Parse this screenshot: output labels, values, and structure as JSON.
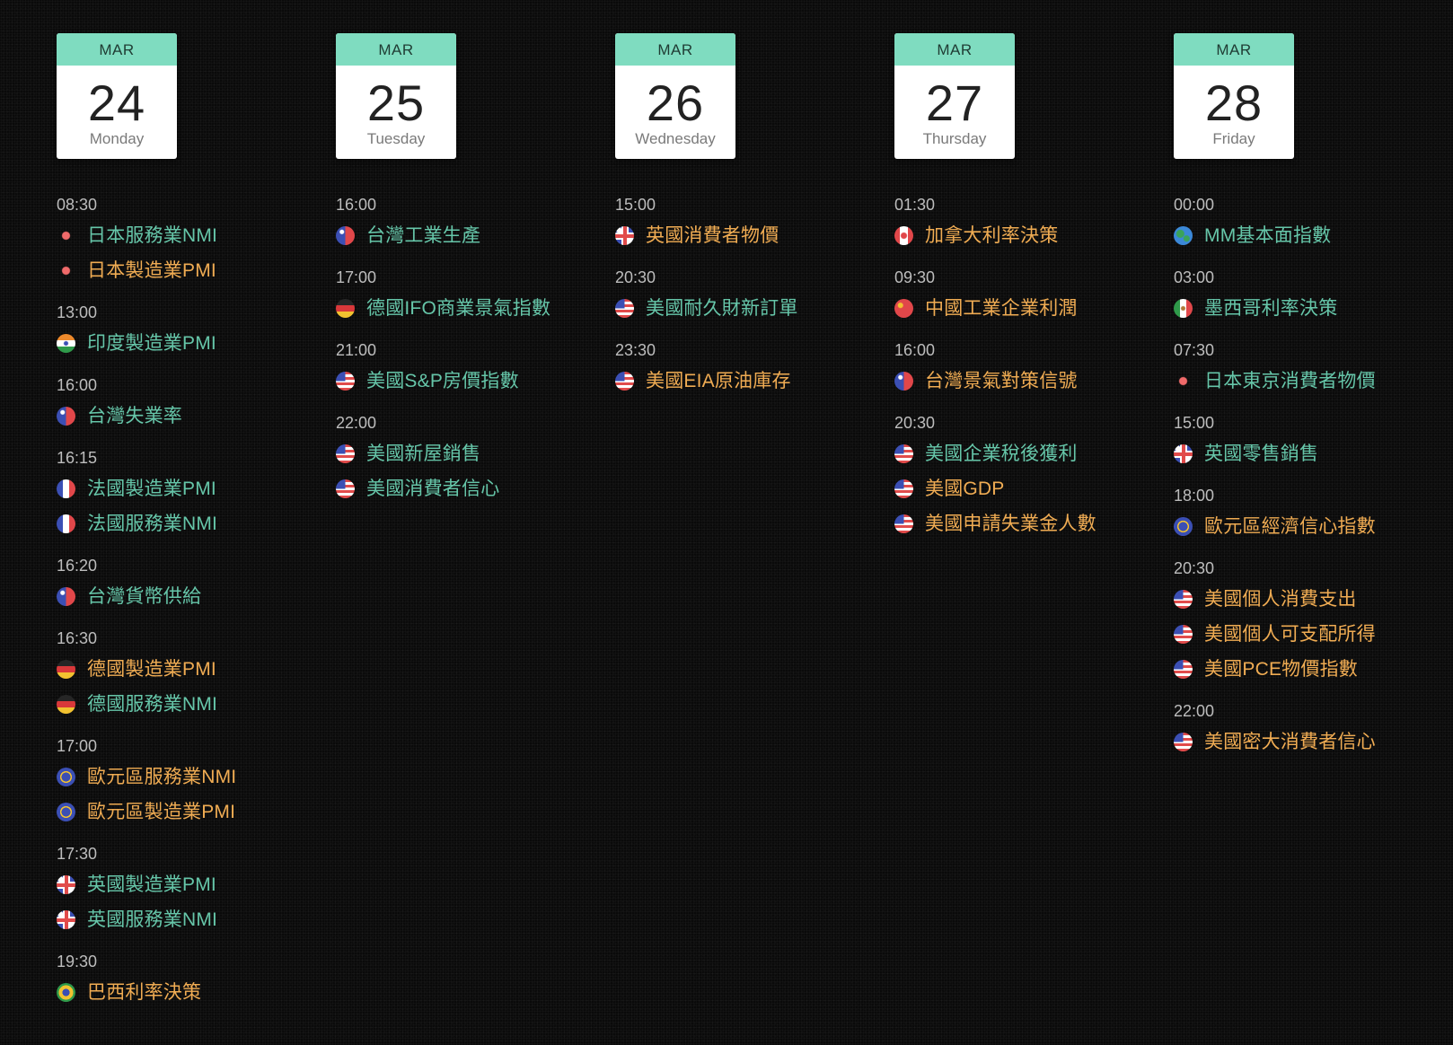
{
  "colors": {
    "accent_header": "#7fdcc0",
    "event_teal": "#66c6a9",
    "event_orange": "#f0ac53",
    "time": "#bdbdbd",
    "background": "#0a0a0a"
  },
  "days": [
    {
      "month": "MAR",
      "day": "24",
      "weekday": "Monday",
      "groups": [
        {
          "time": "08:30",
          "events": [
            {
              "flag": "japan-flag-icon",
              "name": "日本服務業NMI",
              "color": "teal"
            },
            {
              "flag": "japan-flag-icon",
              "name": "日本製造業PMI",
              "color": "orange"
            }
          ]
        },
        {
          "time": "13:00",
          "events": [
            {
              "flag": "india-flag-icon",
              "name": "印度製造業PMI",
              "color": "teal"
            }
          ]
        },
        {
          "time": "16:00",
          "events": [
            {
              "flag": "taiwan-flag-icon",
              "name": "台灣失業率",
              "color": "teal"
            }
          ]
        },
        {
          "time": "16:15",
          "events": [
            {
              "flag": "france-flag-icon",
              "name": "法國製造業PMI",
              "color": "teal"
            },
            {
              "flag": "france-flag-icon",
              "name": "法國服務業NMI",
              "color": "teal"
            }
          ]
        },
        {
          "time": "16:20",
          "events": [
            {
              "flag": "taiwan-flag-icon",
              "name": "台灣貨幣供給",
              "color": "teal"
            }
          ]
        },
        {
          "time": "16:30",
          "events": [
            {
              "flag": "germany-flag-icon",
              "name": "德國製造業PMI",
              "color": "orange"
            },
            {
              "flag": "germany-flag-icon",
              "name": "德國服務業NMI",
              "color": "teal"
            }
          ]
        },
        {
          "time": "17:00",
          "events": [
            {
              "flag": "eu-flag-icon",
              "name": "歐元區服務業NMI",
              "color": "orange"
            },
            {
              "flag": "eu-flag-icon",
              "name": "歐元區製造業PMI",
              "color": "orange"
            }
          ]
        },
        {
          "time": "17:30",
          "events": [
            {
              "flag": "uk-flag-icon",
              "name": "英國製造業PMI",
              "color": "teal"
            },
            {
              "flag": "uk-flag-icon",
              "name": "英國服務業NMI",
              "color": "teal"
            }
          ]
        },
        {
          "time": "19:30",
          "events": [
            {
              "flag": "brazil-flag-icon",
              "name": "巴西利率決策",
              "color": "orange"
            }
          ]
        }
      ]
    },
    {
      "month": "MAR",
      "day": "25",
      "weekday": "Tuesday",
      "groups": [
        {
          "time": "16:00",
          "events": [
            {
              "flag": "taiwan-flag-icon",
              "name": "台灣工業生產",
              "color": "teal"
            }
          ]
        },
        {
          "time": "17:00",
          "events": [
            {
              "flag": "germany-flag-icon",
              "name": "德國IFO商業景氣指數",
              "color": "teal"
            }
          ]
        },
        {
          "time": "21:00",
          "events": [
            {
              "flag": "usa-flag-icon",
              "name": "美國S&P房價指數",
              "color": "teal"
            }
          ]
        },
        {
          "time": "22:00",
          "events": [
            {
              "flag": "usa-flag-icon",
              "name": "美國新屋銷售",
              "color": "teal"
            },
            {
              "flag": "usa-flag-icon",
              "name": "美國消費者信心",
              "color": "teal"
            }
          ]
        }
      ]
    },
    {
      "month": "MAR",
      "day": "26",
      "weekday": "Wednesday",
      "groups": [
        {
          "time": "15:00",
          "events": [
            {
              "flag": "uk-flag-icon",
              "name": "英國消費者物價",
              "color": "orange"
            }
          ]
        },
        {
          "time": "20:30",
          "events": [
            {
              "flag": "usa-flag-icon",
              "name": "美國耐久財新訂單",
              "color": "teal"
            }
          ]
        },
        {
          "time": "23:30",
          "events": [
            {
              "flag": "usa-flag-icon",
              "name": "美國EIA原油庫存",
              "color": "orange"
            }
          ]
        }
      ]
    },
    {
      "month": "MAR",
      "day": "27",
      "weekday": "Thursday",
      "groups": [
        {
          "time": "01:30",
          "events": [
            {
              "flag": "canada-flag-icon",
              "name": "加拿大利率決策",
              "color": "orange"
            }
          ]
        },
        {
          "time": "09:30",
          "events": [
            {
              "flag": "china-flag-icon",
              "name": "中國工業企業利潤",
              "color": "orange"
            }
          ]
        },
        {
          "time": "16:00",
          "events": [
            {
              "flag": "taiwan-flag-icon",
              "name": "台灣景氣對策信號",
              "color": "orange"
            }
          ]
        },
        {
          "time": "20:30",
          "events": [
            {
              "flag": "usa-flag-icon",
              "name": "美國企業稅後獲利",
              "color": "teal"
            },
            {
              "flag": "usa-flag-icon",
              "name": "美國GDP",
              "color": "orange"
            },
            {
              "flag": "usa-flag-icon",
              "name": "美國申請失業金人數",
              "color": "orange"
            }
          ]
        }
      ]
    },
    {
      "month": "MAR",
      "day": "28",
      "weekday": "Friday",
      "groups": [
        {
          "time": "00:00",
          "events": [
            {
              "flag": "globe-icon",
              "name": "MM基本面指數",
              "color": "teal"
            }
          ]
        },
        {
          "time": "03:00",
          "events": [
            {
              "flag": "mexico-flag-icon",
              "name": "墨西哥利率決策",
              "color": "teal"
            }
          ]
        },
        {
          "time": "07:30",
          "events": [
            {
              "flag": "japan-flag-icon",
              "name": "日本東京消費者物價",
              "color": "teal"
            }
          ]
        },
        {
          "time": "15:00",
          "events": [
            {
              "flag": "uk-flag-icon",
              "name": "英國零售銷售",
              "color": "teal"
            }
          ]
        },
        {
          "time": "18:00",
          "events": [
            {
              "flag": "eu-flag-icon",
              "name": "歐元區經濟信心指數",
              "color": "orange"
            }
          ]
        },
        {
          "time": "20:30",
          "events": [
            {
              "flag": "usa-flag-icon",
              "name": "美國個人消費支出",
              "color": "orange"
            },
            {
              "flag": "usa-flag-icon",
              "name": "美國個人可支配所得",
              "color": "orange"
            },
            {
              "flag": "usa-flag-icon",
              "name": "美國PCE物價指數",
              "color": "orange"
            }
          ]
        },
        {
          "time": "22:00",
          "events": [
            {
              "flag": "usa-flag-icon",
              "name": "美國密大消費者信心",
              "color": "orange"
            }
          ]
        }
      ]
    }
  ]
}
